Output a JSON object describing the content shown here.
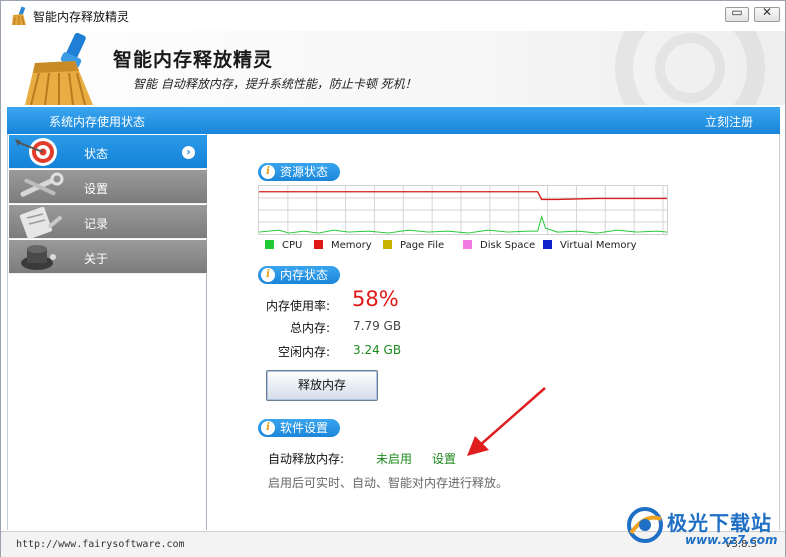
{
  "window": {
    "title": "智能内存释放精灵",
    "min_glyph": "▭",
    "close_glyph": "✕"
  },
  "header": {
    "title": "智能内存释放精灵",
    "subtitle": "智能 自动释放内存，提升系统性能，防止卡顿 死机！"
  },
  "bluebar": {
    "left": "系统内存使用状态",
    "right": "立刻注册"
  },
  "sidebar": {
    "items": [
      {
        "label": "状态",
        "icon": "target-icon",
        "active": true
      },
      {
        "label": "设置",
        "icon": "tools-icon",
        "active": false
      },
      {
        "label": "记录",
        "icon": "clipboard-icon",
        "active": false
      },
      {
        "label": "关于",
        "icon": "info-dial-icon",
        "active": false
      }
    ],
    "arrow_glyph": "›"
  },
  "resource": {
    "title": "资源状态",
    "legend": [
      {
        "name": "CPU",
        "color": "#22c934"
      },
      {
        "name": "Memory",
        "color": "#e01818"
      },
      {
        "name": "Page File",
        "color": "#c8b400"
      },
      {
        "name": "Disk Space",
        "color": "#f07ae0"
      },
      {
        "name": "Virtual Memory",
        "color": "#1020c8"
      }
    ]
  },
  "memory": {
    "title": "内存状态",
    "usage_label": "内存使用率:",
    "usage_value": "58%",
    "total_label": "总内存:",
    "total_value": "7.79 GB",
    "free_label": "空闲内存:",
    "free_value": "3.24 GB",
    "release_button": "释放内存"
  },
  "software": {
    "title": "软件设置",
    "auto_label": "自动释放内存:",
    "auto_status": "未启用",
    "settings_link": "设置",
    "note": "启用后可实时、自动、智能对内存进行释放。"
  },
  "statusbar": {
    "url": "http://www.fairysoftware.com",
    "version": "V3.8.3"
  },
  "watermark": {
    "brand": "极光下载站",
    "url": "www.xz7.com"
  },
  "colors": {
    "accent_blue": "#1785da",
    "usage_red": "#e01818",
    "green_text": "#1c8a1c"
  }
}
